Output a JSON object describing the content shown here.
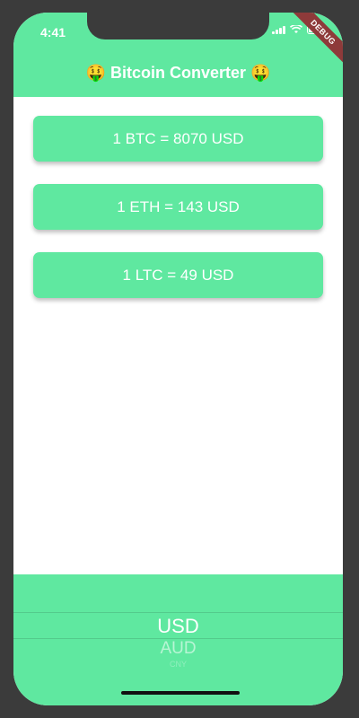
{
  "status_bar": {
    "time": "4:41",
    "debug_label": "DEBUG"
  },
  "app_bar": {
    "title": "🤑 Bitcoin Converter 🤑",
    "background_color": "#5fe8a0"
  },
  "rates": [
    {
      "text": "1 BTC = 8070 USD"
    },
    {
      "text": "1 ETH = 143 USD"
    },
    {
      "text": "1 LTC = 49 USD"
    }
  ],
  "currency_picker": {
    "selected": "USD",
    "next": "AUD",
    "next2": "CNY"
  },
  "colors": {
    "accent": "#5fe8a0",
    "text_on_accent": "#ffffff"
  }
}
